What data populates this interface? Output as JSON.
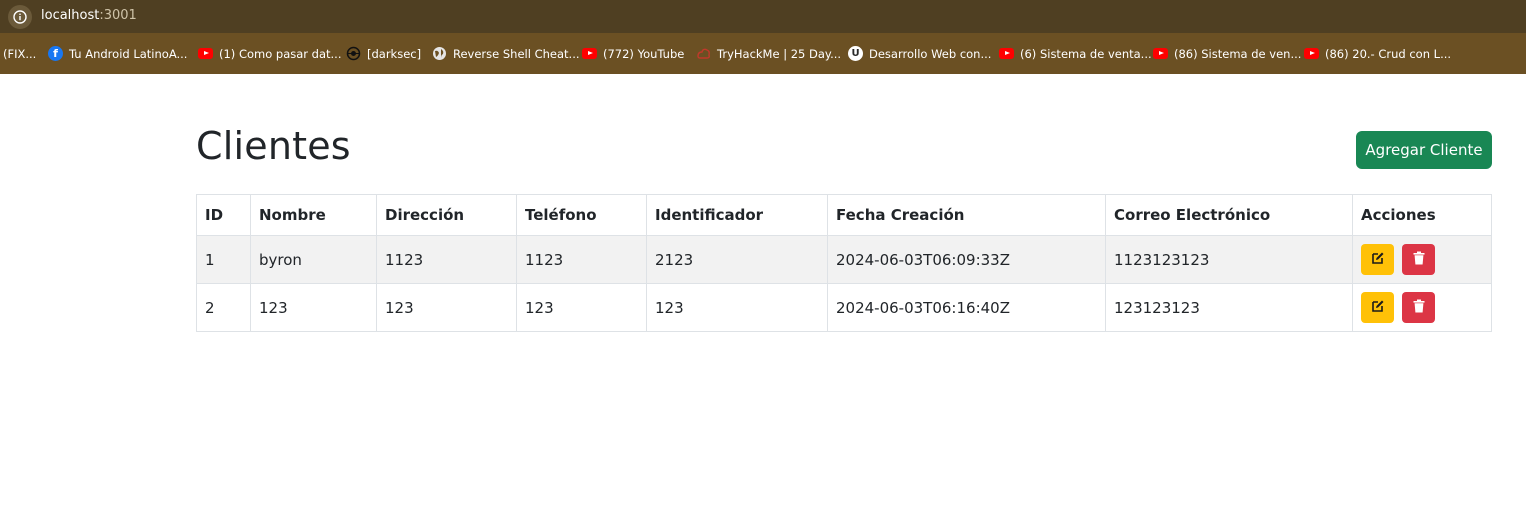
{
  "browser": {
    "url_host": "localhost",
    "url_port": ":3001",
    "bookmarks": [
      {
        "label": "(FIX...",
        "icon": "none"
      },
      {
        "label": "Tu Android LatinoA...",
        "icon": "facebook-icon"
      },
      {
        "label": "(1) Como pasar dat...",
        "icon": "youtube-icon"
      },
      {
        "label": "[darksec]",
        "icon": "darksec-icon"
      },
      {
        "label": "Reverse Shell Cheat...",
        "icon": "globe-icon"
      },
      {
        "label": "(772) YouTube",
        "icon": "youtube-icon"
      },
      {
        "label": "TryHackMe | 25 Day...",
        "icon": "tryhackme-icon"
      },
      {
        "label": "Desarrollo Web con...",
        "icon": "udemy-icon"
      },
      {
        "label": "(6) Sistema de venta...",
        "icon": "youtube-icon"
      },
      {
        "label": "(86) Sistema de ven...",
        "icon": "youtube-icon"
      },
      {
        "label": "(86) 20.- Crud con L...",
        "icon": "youtube-icon"
      }
    ]
  },
  "page": {
    "title": "Clientes",
    "add_button_label": "Agregar Cliente"
  },
  "table": {
    "headers": [
      "ID",
      "Nombre",
      "Dirección",
      "Teléfono",
      "Identificador",
      "Fecha Creación",
      "Correo Electrónico",
      "Acciones"
    ],
    "rows": [
      [
        "1",
        "byron",
        "1123",
        "1123",
        "2123",
        "2024-06-03T06:09:33Z",
        "1123123123"
      ],
      [
        "2",
        "123",
        "123",
        "123",
        "123",
        "2024-06-03T06:16:40Z",
        "123123123"
      ]
    ]
  },
  "colors": {
    "address_bar": "#4f3f22",
    "bookmarks_bar": "#6b5023",
    "success": "#198754",
    "warning": "#ffc107",
    "danger": "#dc3545"
  }
}
